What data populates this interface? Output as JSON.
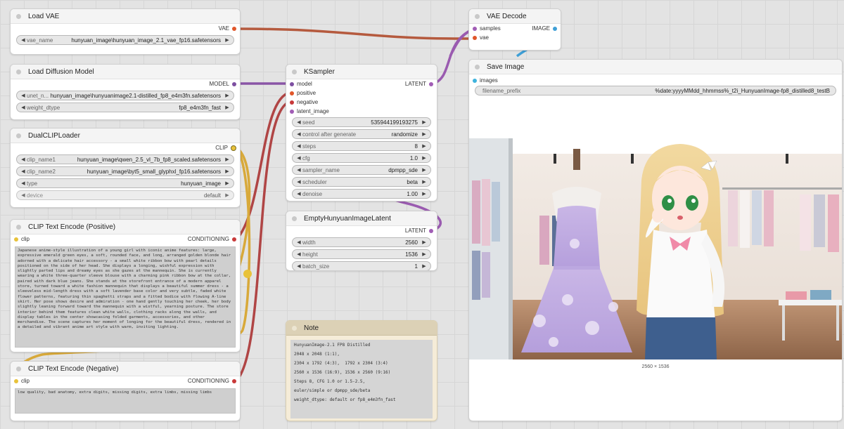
{
  "nodes": {
    "load_vae": {
      "title": "Load VAE",
      "out": "VAE",
      "widgets": [
        {
          "label": "vae_name",
          "value": "hunyuan_image\\hunyuan_image_2.1_vae_fp16.safetensors"
        }
      ]
    },
    "load_diffusion": {
      "title": "Load Diffusion Model",
      "out": "MODEL",
      "widgets": [
        {
          "label": "unet_n...",
          "value": "hunyuan_image\\hunyuanimage2.1-distilled_fp8_e4m3fn.safetensors"
        },
        {
          "label": "weight_dtype",
          "value": "fp8_e4m3fn_fast"
        }
      ]
    },
    "dual_clip": {
      "title": "DualCLIPLoader",
      "out": "CLIP",
      "widgets": [
        {
          "label": "clip_name1",
          "value": "hunyuan_image\\qwen_2.5_vl_7b_fp8_scaled.safetensors"
        },
        {
          "label": "clip_name2",
          "value": "hunyuan_image\\byt5_small_glyphxl_fp16.safetensors"
        },
        {
          "label": "type",
          "value": "hunyuan_image"
        },
        {
          "label": "device",
          "value": "default"
        }
      ]
    },
    "clip_pos": {
      "title": "CLIP Text Encode (Positive)",
      "in": "clip",
      "out": "CONDITIONING",
      "text": "Japanese anime-style illustration of a young girl with iconic anime features: large, expressive emerald green eyes, a soft, rounded face, and long, arranged golden blonde hair adorned with a delicate hair accessory - a small white ribbon bow with pearl details positioned on the side of her head. She displays a longing, wishful expression with slightly parted lips and dreamy eyes as she gazes at the mannequin. She is currently wearing a white three-quarter sleeve blouse with a charming pink ribbon bow at the collar, paired with dark blue jeans. She stands at the storefront entrance of a modern apparel store, turned toward a white fashion mannequin that displays a beautiful summer dress - a sleeveless mid-length dress with a soft lavender base color and very subtle, faded white flower patterns, featuring thin spaghetti straps and a fitted bodice with flowing A-line skirt. Her pose shows desire and admiration - one hand gently touching her cheek, her body slightly leaning forward toward the mannequin with a wistful, yearning posture. The store interior behind them features clean white walls, clothing racks along the walls, and display tables in the center showcasing folded garments, accessories, and other merchandise. The scene captures her moment of longing for the beautiful dress, rendered in a detailed and vibrant anime art style with warm, inviting lighting."
    },
    "clip_neg": {
      "title": "CLIP Text Encode (Negative)",
      "in": "clip",
      "out": "CONDITIONING",
      "text": "low quality, bad anatomy, extra digits, missing digits, extra limbs, missing limbs"
    },
    "ksampler": {
      "title": "KSampler",
      "inputs": [
        "model",
        "positive",
        "negative",
        "latent_image"
      ],
      "out": "LATENT",
      "widgets": [
        {
          "label": "seed",
          "value": "535944199193275"
        },
        {
          "label": "control after generate",
          "value": "randomize"
        },
        {
          "label": "steps",
          "value": "8"
        },
        {
          "label": "cfg",
          "value": "1.0"
        },
        {
          "label": "sampler_name",
          "value": "dpmpp_sde"
        },
        {
          "label": "scheduler",
          "value": "beta"
        },
        {
          "label": "denoise",
          "value": "1.00"
        }
      ]
    },
    "empty_latent": {
      "title": "EmptyHunyuanImageLatent",
      "out": "LATENT",
      "widgets": [
        {
          "label": "width",
          "value": "2560"
        },
        {
          "label": "height",
          "value": "1536"
        },
        {
          "label": "batch_size",
          "value": "1"
        }
      ]
    },
    "note": {
      "title": "Note",
      "lines": [
        "HunyuanImage-2.1 FP8 Distilled",
        "2048 x 2048 (1:1),",
        "2304 x 1792 (4:3),  1792 x 2304 (3:4)",
        "2560 x 1536 (16:9), 1536 x 2560 (9:16)",
        "Steps 8, CFG 1.0 or 1.5-2.5,",
        "euler/simple or dpmpp_sde/beta",
        "weight_dtype: default or fp8_e4m3fn_fast"
      ]
    },
    "vae_decode": {
      "title": "VAE Decode",
      "inputs": [
        "samples",
        "vae"
      ],
      "out": "IMAGE"
    },
    "save_image": {
      "title": "Save Image",
      "in": "images",
      "widgets": [
        {
          "label": "filename_prefix",
          "value": "%date:yyyyMMdd_hhmmss%_t2i_HunyuanImage-fp8_distilled8_testB"
        }
      ],
      "dimensions": "2560 × 1536"
    }
  },
  "icons": {
    "widget_left": "◀",
    "widget_right": "▶"
  },
  "colors": {
    "model": "#a15db5",
    "clip": "#e8c23a",
    "vae": "#e0562a",
    "conditioning": "#c83a3a",
    "latent": "#a15db5",
    "image": "#3f9fd6",
    "images_in": "#3fb3dd"
  }
}
